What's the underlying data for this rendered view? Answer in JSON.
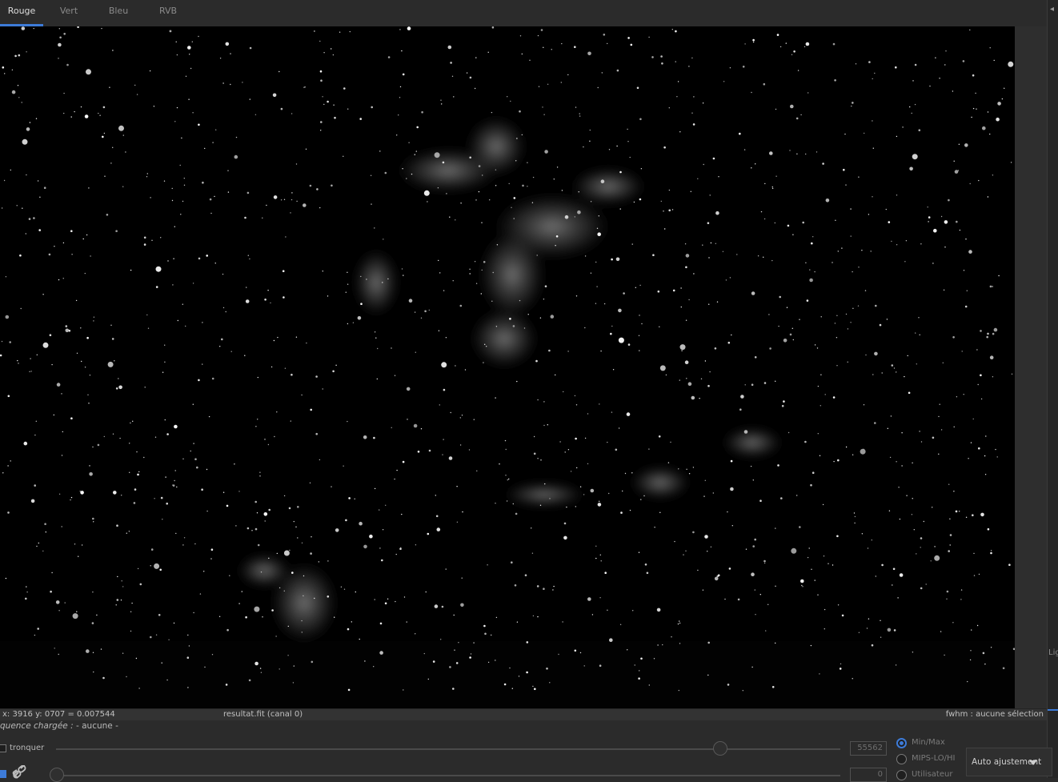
{
  "tabs": [
    {
      "label": "Rouge",
      "active": true
    },
    {
      "label": "Vert",
      "active": false
    },
    {
      "label": "Bleu",
      "active": false
    },
    {
      "label": "RVB",
      "active": false
    }
  ],
  "status_bar": {
    "coords": "x: 3916 y: 0707 = 0.007544",
    "filename": "resultat.fit (canal 0)",
    "fwhm": "fwhm : aucune sélection"
  },
  "sequence": {
    "label": "quence chargée :",
    "value": " - aucune -"
  },
  "controls": {
    "truncate_label": "tronquer",
    "truncate_checked": false,
    "max_value": "55562",
    "min_value": "0",
    "link_checked": true,
    "radio_options": [
      {
        "label": "Min/Max",
        "selected": true
      },
      {
        "label": "MIPS-LO/HI",
        "selected": false
      },
      {
        "label": "Utilisateur",
        "selected": false
      }
    ],
    "scaling_dropdown": "Auto ajustement"
  },
  "side_panel": {
    "label": "Lig"
  },
  "icons": {
    "link": "link-icon",
    "side_arrow": "chevron-left-icon",
    "dropdown": "chevron-down-icon"
  }
}
